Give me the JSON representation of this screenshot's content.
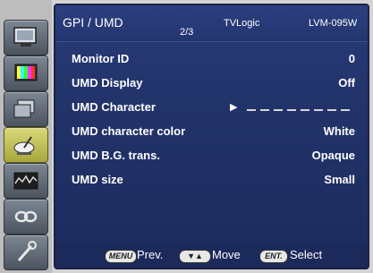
{
  "header": {
    "title": "GPI / UMD",
    "page": "2/3",
    "brand": "TVLogic",
    "model": "LVM-095W"
  },
  "sidebar": {
    "icons": [
      "monitor-icon",
      "color-bars-icon",
      "display-settings-icon",
      "satellite-dish-icon",
      "waveform-icon",
      "infinity-link-icon",
      "tools-icon"
    ],
    "active_index": 3
  },
  "menu": {
    "rows": [
      {
        "label": "Monitor ID",
        "value": "0"
      },
      {
        "label": "UMD Display",
        "value": "Off"
      },
      {
        "label": "UMD Character",
        "value": "",
        "cursor": "▶"
      },
      {
        "label": "UMD character color",
        "value": "White"
      },
      {
        "label": "UMD B.G. trans.",
        "value": "Opaque"
      },
      {
        "label": "UMD size",
        "value": "Small"
      }
    ]
  },
  "footer": {
    "menu_key": "MENU",
    "prev_label": "Prev.",
    "updown_key": "▼▲",
    "move_label": "Move",
    "ent_key": "ENT.",
    "select_label": "Select"
  },
  "colors": {
    "panel_bg": "#22336a",
    "text": "#ffffff",
    "active_icon": "#c9c85a"
  }
}
